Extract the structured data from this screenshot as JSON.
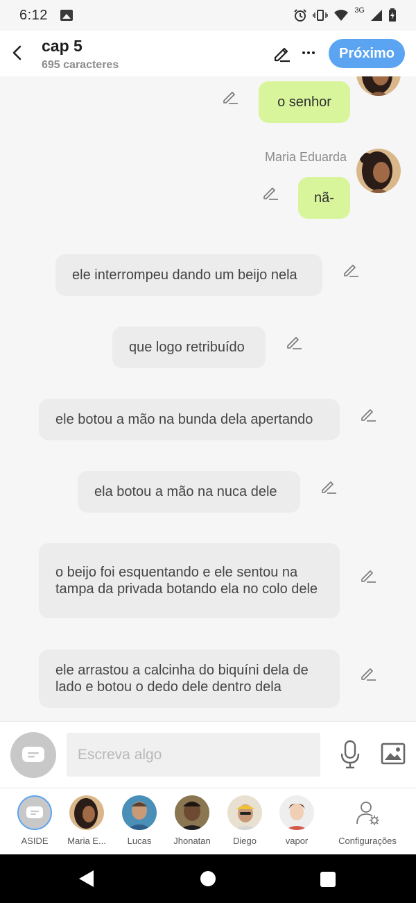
{
  "status_bar": {
    "time": "6:12",
    "network": "3G"
  },
  "header": {
    "title": "cap 5",
    "subtitle": "695 caracteres",
    "next_label": "Próximo"
  },
  "messages": [
    {
      "type": "character",
      "text": "o senhor"
    },
    {
      "type": "character",
      "sender": "Maria Eduarda",
      "text": "nã-"
    },
    {
      "type": "narration",
      "text": "ele interrompeu dando um beijo nela"
    },
    {
      "type": "narration",
      "text": "que logo retribuído"
    },
    {
      "type": "narration",
      "text": "ele botou a mão na bunda dela apertando"
    },
    {
      "type": "narration",
      "text": "ela botou a mão na nuca dele"
    },
    {
      "type": "narration",
      "text": "o beijo foi esquentando e ele sentou na tampa da privada botando ela no colo dele"
    },
    {
      "type": "narration",
      "text": "ele arrastou a calcinha do biquíni dela de lado e botou o dedo dele dentro dela"
    }
  ],
  "input": {
    "placeholder": "Escreva algo"
  },
  "characters": [
    {
      "label": "ASIDE"
    },
    {
      "label": "Maria E..."
    },
    {
      "label": "Lucas"
    },
    {
      "label": "Jhonatan"
    },
    {
      "label": "Diego"
    },
    {
      "label": "vapor"
    },
    {
      "label": "Configurações"
    }
  ],
  "colors": {
    "accent": "#5aa4f2",
    "character_bubble": "#d9f59c",
    "narration_bubble": "#ececec"
  }
}
